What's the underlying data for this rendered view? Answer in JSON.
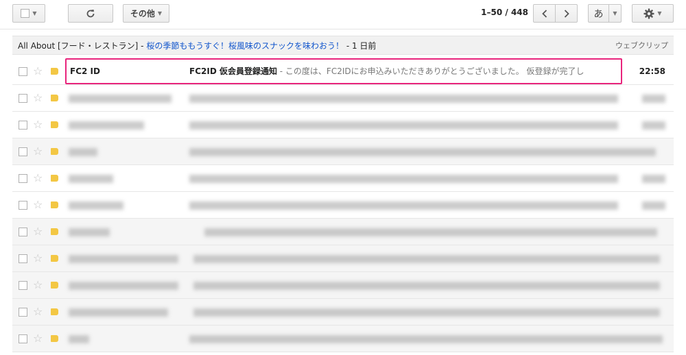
{
  "toolbar": {
    "more_label": "その他",
    "pager": "1–50 / 448",
    "input_tool_label": "あ",
    "icons": [
      "select-checkbox-icon",
      "refresh-icon",
      "chevron-left-icon",
      "chevron-right-icon",
      "gear-icon"
    ]
  },
  "adline": {
    "source": "All About [フード・レストラン] -",
    "link": "桜の季節ももうすぐ！桜風味のスナックを味わおう！",
    "age": "- 1 日前",
    "webclip": "ウェブクリップ"
  },
  "first_email": {
    "sender": "FC2 ID",
    "subject": "FC2ID 仮会員登録通知",
    "snippet": " - この度は、FC2IDにお申込みいただきありがとうございました。 仮登録が完了し",
    "time": "22:58"
  },
  "colors": {
    "highlight": "#e8247c",
    "label": "#f3c744",
    "link": "#1155cc"
  }
}
